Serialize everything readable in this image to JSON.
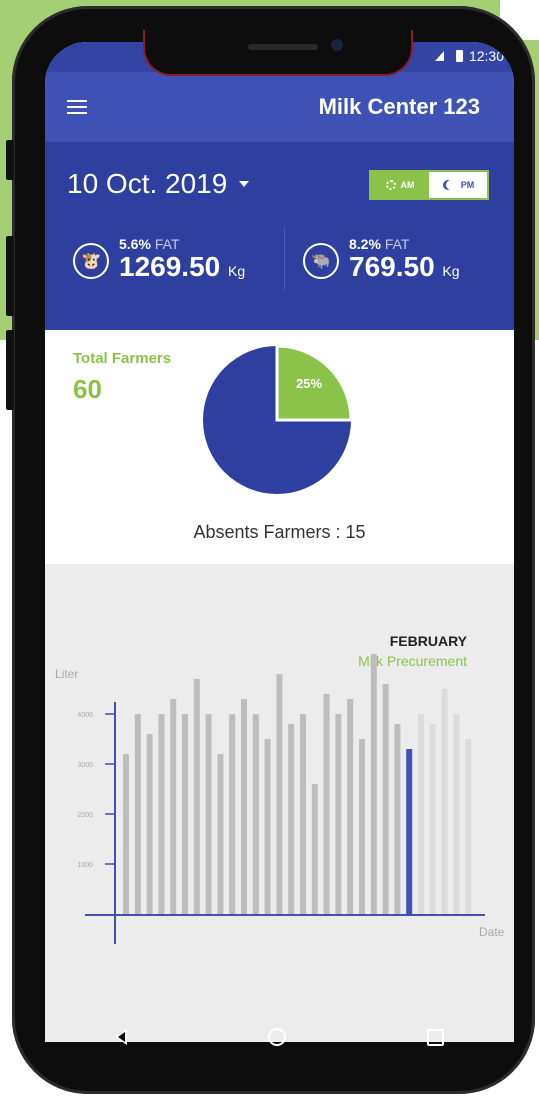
{
  "status_bar": {
    "time": "12:30"
  },
  "app_bar": {
    "title": "Milk Center 123",
    "menu_icon": "hamburger-icon"
  },
  "header": {
    "date": "10 Oct. 2019",
    "toggle": {
      "am_label": "AM",
      "pm_label": "PM",
      "selected": "AM"
    },
    "stats": [
      {
        "fat_percent": "5.6%",
        "fat_label": "FAT",
        "weight": "1269.50",
        "unit": "Kg",
        "icon": "cow-icon"
      },
      {
        "fat_percent": "8.2%",
        "fat_label": "FAT",
        "weight": "769.50",
        "unit": "Kg",
        "icon": "buffalo-icon"
      }
    ]
  },
  "farmers": {
    "total_label": "Total Farmers",
    "total_value": "60",
    "absent_text": "Absents Farmers : 15",
    "pie_label": "25%",
    "absent_fraction": 0.25
  },
  "colors": {
    "primary": "#3f51b5",
    "primary_dark": "#2f3f9f",
    "accent": "#8bc34a"
  },
  "chart_data": {
    "type": "bar",
    "title": "FEBRUARY",
    "subtitle": "Milk Precurement",
    "ylabel": "Liter",
    "xlabel": "Date",
    "yticks": [
      "4000",
      "3000",
      "2000",
      "1000"
    ],
    "ylim": [
      0,
      5000
    ],
    "values": [
      3200,
      4000,
      3600,
      4000,
      4300,
      4000,
      4700,
      4000,
      3200,
      4000,
      4300,
      4000,
      3500,
      4800,
      3800,
      4000,
      2600,
      4400,
      4000,
      4300,
      3500,
      5200,
      4600,
      3800,
      3300
    ],
    "highlight_index": 24,
    "future_values": [
      4000,
      3800,
      4500,
      4000,
      3500
    ],
    "highlight_color": "#3f51b5",
    "bar_color": "#bdbdbd",
    "future_color": "#dcdcdc"
  }
}
